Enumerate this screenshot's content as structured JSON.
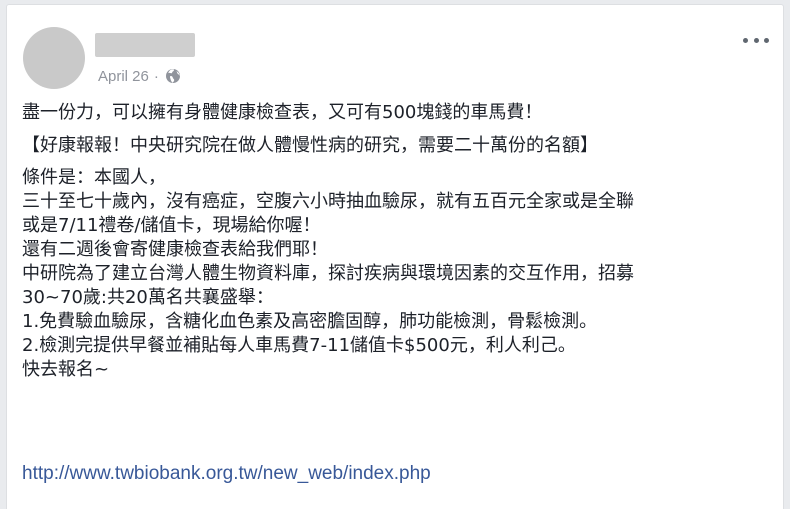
{
  "post": {
    "author_name": "",
    "date": "April 26",
    "separator": "·",
    "privacy_icon": "globe-icon",
    "more_icon": "more-options-icon",
    "paragraphs": {
      "p1": "盡一份力，可以擁有身體健康檢查表，又可有500塊錢的車馬費！",
      "p2": "【好康報報！中央研究院在做人體慢性病的研究，需要二十萬份的名額】"
    },
    "lines": [
      "條件是：本國人，",
      "三十至七十歲內，沒有癌症，空腹六小時抽血驗尿，就有五百元全家或是全聯",
      "或是7/11禮卷/儲值卡，現場給你喔！",
      "還有二週後會寄健康檢查表給我們耶！",
      "中研院為了建立台灣人體生物資料庫，探討疾病與環境因素的交互作用，招募",
      "30~70歲:共20萬名共襄盛舉：",
      "1.免費驗血驗尿，含糖化血色素及高密膽固醇，肺功能檢測，骨鬆檢測。",
      "2.檢測完提供早餐並補貼每人車馬費7-11儲值卡$500元，利人利己。",
      "快去報名~"
    ],
    "link": "http://www.twbiobank.org.tw/new_web/index.php"
  },
  "colors": {
    "background": "#e9ebee",
    "card": "#ffffff",
    "text": "#1d2129",
    "meta": "#90949c",
    "link": "#385898"
  }
}
